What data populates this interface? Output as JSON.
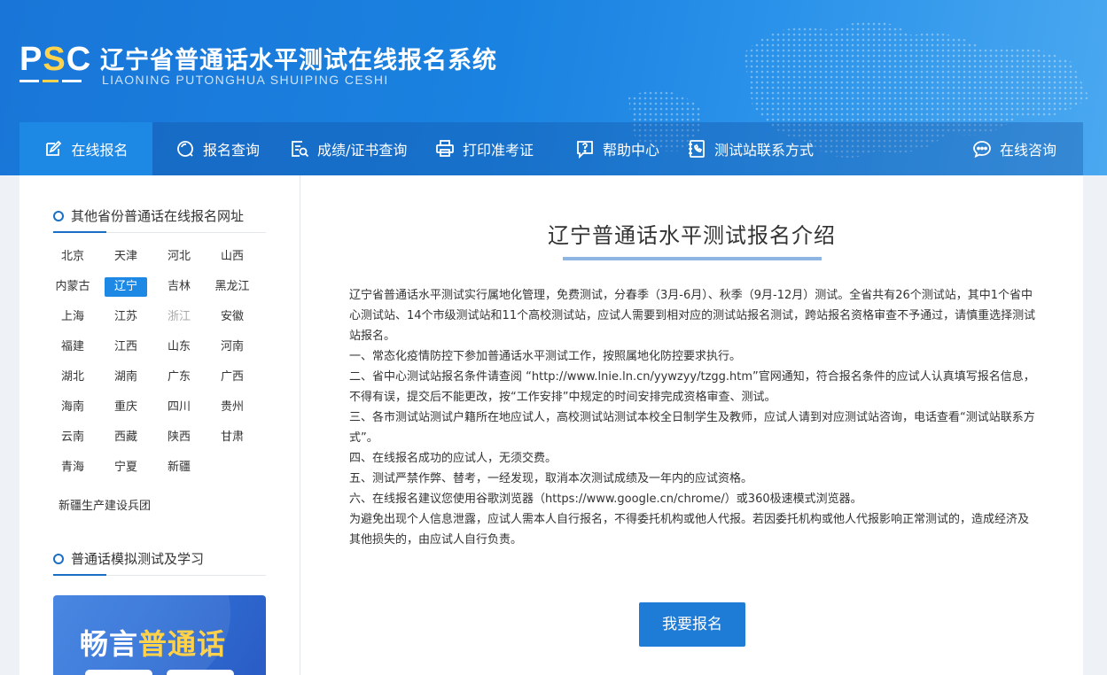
{
  "header": {
    "logo_text_p": "P",
    "logo_text_s": "S",
    "logo_text_c": "C",
    "title": "辽宁省普通话水平测试在线报名系统",
    "subtitle": "LIAONING PUTONGHUA SHUIPING CESHI"
  },
  "nav": {
    "items": [
      {
        "label": "在线报名",
        "icon": "edit-icon"
      },
      {
        "label": "报名查询",
        "icon": "search-circle-icon"
      },
      {
        "label": "成绩/证书查询",
        "icon": "document-search-icon"
      },
      {
        "label": "打印准考证",
        "icon": "printer-icon"
      },
      {
        "label": "帮助中心",
        "icon": "help-icon"
      },
      {
        "label": "测试站联系方式",
        "icon": "phone-book-icon"
      }
    ],
    "consult": {
      "label": "在线咨询",
      "icon": "chat-icon"
    }
  },
  "sidebar": {
    "provinces_heading": "其他省份普通话在线报名网址",
    "provinces": [
      [
        "北京",
        "天津",
        "河北",
        "山西"
      ],
      [
        "内蒙古",
        "辽宁",
        "吉林",
        "黑龙江"
      ],
      [
        "上海",
        "江苏",
        "浙江",
        "安徽"
      ],
      [
        "福建",
        "江西",
        "山东",
        "河南"
      ],
      [
        "湖北",
        "湖南",
        "广东",
        "广西"
      ],
      [
        "海南",
        "重庆",
        "四川",
        "贵州"
      ],
      [
        "云南",
        "西藏",
        "陕西",
        "甘肃"
      ],
      [
        "青海",
        "宁夏",
        "新疆"
      ]
    ],
    "active_province": "辽宁",
    "muted_province": "浙江",
    "bingtuan": "新疆生产建设兵团",
    "study_heading": "普通话模拟测试及学习",
    "banner_text_a": "畅言",
    "banner_text_b": "普通话"
  },
  "main": {
    "title": "辽宁普通话水平测试报名介绍",
    "paragraphs": [
      "辽宁省普通话水平测试实行属地化管理，免费测试，分春季（3月-6月）、秋季（9月-12月）测试。全省共有26个测试站，其中1个省中心测试站、14个市级测试站和11个高校测试站，应试人需要到相对应的测试站报名测试，跨站报名资格审查不予通过，请慎重选择测试站报名。",
      "一、常态化疫情防控下参加普通话水平测试工作，按照属地化防控要求执行。",
      "二、省中心测试站报名条件请查阅 “http://www.lnie.ln.cn/yywzyy/tzgg.htm”官网通知，符合报名条件的应试人认真填写报名信息，不得有误，提交后不能更改，按“工作安排”中规定的时间安排完成资格审查、测试。",
      "三、各市测试站测试户籍所在地应试人，高校测试站测试本校全日制学生及教师，应试人请到对应测试站咨询，电话查看“测试站联系方式”。",
      "四、在线报名成功的应试人，无须交费。",
      "五、测试严禁作弊、替考，一经发现，取消本次测试成绩及一年内的应试资格。",
      "六、在线报名建议您使用谷歌浏览器（https://www.google.cn/chrome/）或360极速模式浏览器。",
      "为避免出现个人信息泄露，应试人需本人自行报名，不得委托机构或他人代报。若因委托机构或他人代报影响正常测试的，造成经济及其他损失的，由应试人自行负责。"
    ],
    "register_button": "我要报名"
  },
  "colors": {
    "header_blue": "#1976d8",
    "active_blue": "#1e88e5",
    "accent_yellow": "#ffd34d"
  }
}
